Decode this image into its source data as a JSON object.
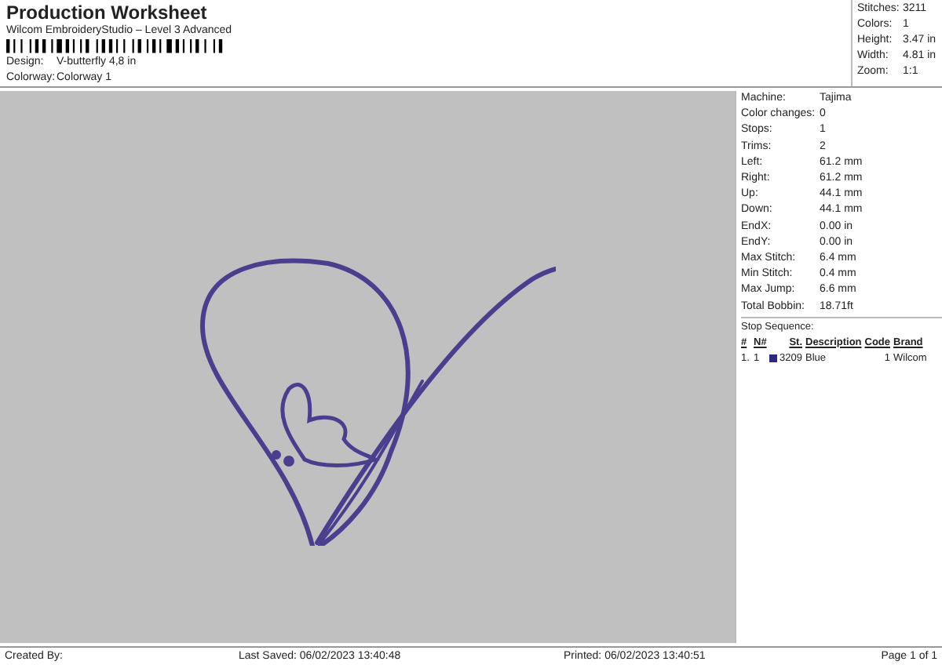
{
  "header": {
    "title": "Production Worksheet",
    "subtitle": "Wilcom EmbroideryStudio – Level 3 Advanced",
    "fields": [
      {
        "label": "Design:",
        "value": "V-butterfly 4,8 in"
      },
      {
        "label": "Colorway:",
        "value": "Colorway 1"
      }
    ]
  },
  "summary": [
    {
      "label": "Stitches:",
      "value": "3211"
    },
    {
      "label": "Colors:",
      "value": "1"
    },
    {
      "label": "Height:",
      "value": "3.47 in"
    },
    {
      "label": "Width:",
      "value": "4.81 in"
    },
    {
      "label": "Zoom:",
      "value": "1:1"
    }
  ],
  "details": [
    {
      "label": "Machine:",
      "value": "Tajima"
    },
    {
      "label": "Color changes:",
      "value": "0"
    },
    {
      "label": "Stops:",
      "value": "1"
    },
    {
      "label": "Trims:",
      "value": "2"
    },
    {
      "label": "Left:",
      "value": "61.2 mm"
    },
    {
      "label": "Right:",
      "value": "61.2 mm"
    },
    {
      "label": "Up:",
      "value": "44.1 mm"
    },
    {
      "label": "Down:",
      "value": "44.1 mm"
    },
    {
      "label": "EndX:",
      "value": "0.00 in"
    },
    {
      "label": "EndY:",
      "value": "0.00 in"
    },
    {
      "label": "Max Stitch:",
      "value": "6.4 mm"
    },
    {
      "label": "Min Stitch:",
      "value": "0.4 mm"
    },
    {
      "label": "Max Jump:",
      "value": "6.6 mm"
    },
    {
      "label": "Total Bobbin:",
      "value": "18.71ft"
    }
  ],
  "stop_sequence": {
    "title": "Stop Sequence:",
    "columns": [
      "#",
      "N#",
      "St.",
      "Description",
      "Code",
      "Brand"
    ],
    "rows": [
      {
        "index": "1.",
        "needle": "1",
        "color": "#2b2a80",
        "stitches": "3209",
        "description": "Blue",
        "code": "1",
        "brand": "Wilcom"
      }
    ]
  },
  "footer": {
    "created": "Created By:",
    "saved": "Last Saved: 06/02/2023 13:40:48",
    "printed": "Printed: 06/02/2023 13:40:51",
    "page": "Page 1 of 1"
  }
}
